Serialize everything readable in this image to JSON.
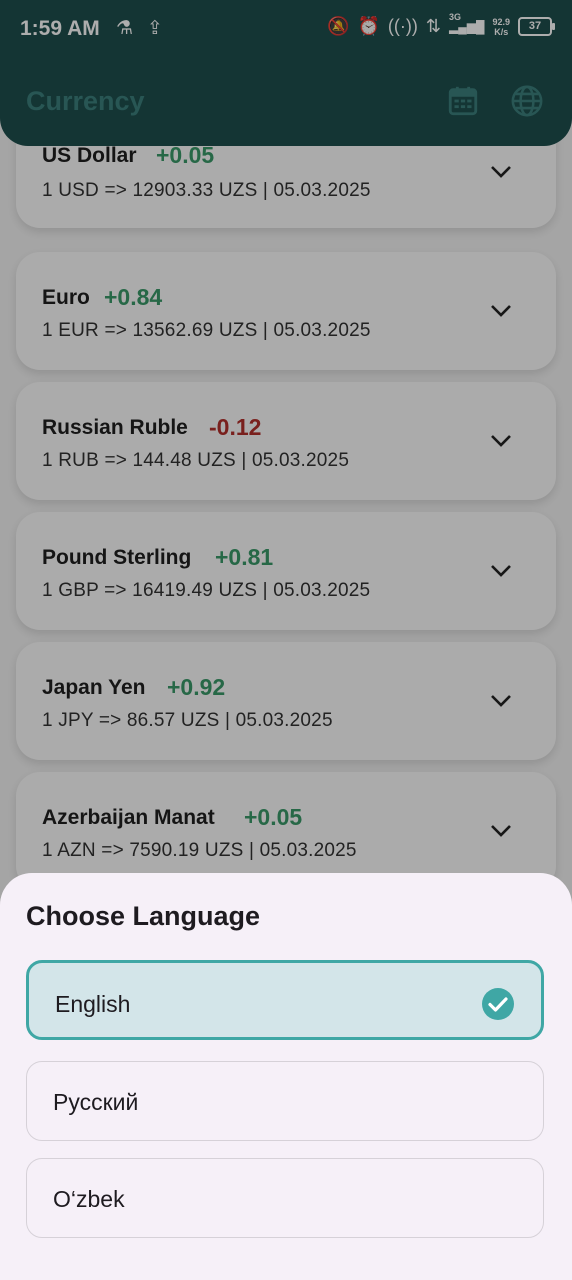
{
  "status_bar": {
    "time": "1:59 AM",
    "network_type": "3G",
    "speed_value": "92.9",
    "speed_unit": "K/s",
    "battery": "37"
  },
  "app_bar": {
    "title": "Currency",
    "calendar_icon": "calendar-icon",
    "language_icon": "globe-icon"
  },
  "currencies": [
    {
      "name": "US Dollar",
      "delta": "+0.05",
      "rate": "1 USD => 12903.33 UZS |  05.03.2025",
      "trend": "up"
    },
    {
      "name": "Euro",
      "delta": "+0.84",
      "rate": "1 EUR => 13562.69 UZS |  05.03.2025",
      "trend": "up"
    },
    {
      "name": "Russian Ruble",
      "delta": "-0.12",
      "rate": "1 RUB => 144.48 UZS |  05.03.2025",
      "trend": "down"
    },
    {
      "name": "Pound Sterling",
      "delta": "+0.81",
      "rate": "1 GBP => 16419.49 UZS |  05.03.2025",
      "trend": "up"
    },
    {
      "name": "Japan Yen",
      "delta": "+0.92",
      "rate": "1 JPY => 86.57 UZS |  05.03.2025",
      "trend": "up"
    },
    {
      "name": "Azerbaijan Manat",
      "delta": "+0.05",
      "rate": "1 AZN => 7590.19 UZS |  05.03.2025",
      "trend": "up"
    }
  ],
  "colors": {
    "up": "#3a9a69",
    "down": "#b3302c",
    "accent": "#3fa7a5",
    "header": "#1e4e4d"
  },
  "language_sheet": {
    "title": "Choose Language",
    "options": [
      {
        "label": "English",
        "selected": true
      },
      {
        "label": "Русский",
        "selected": false
      },
      {
        "label": "O‘zbek",
        "selected": false
      }
    ]
  }
}
